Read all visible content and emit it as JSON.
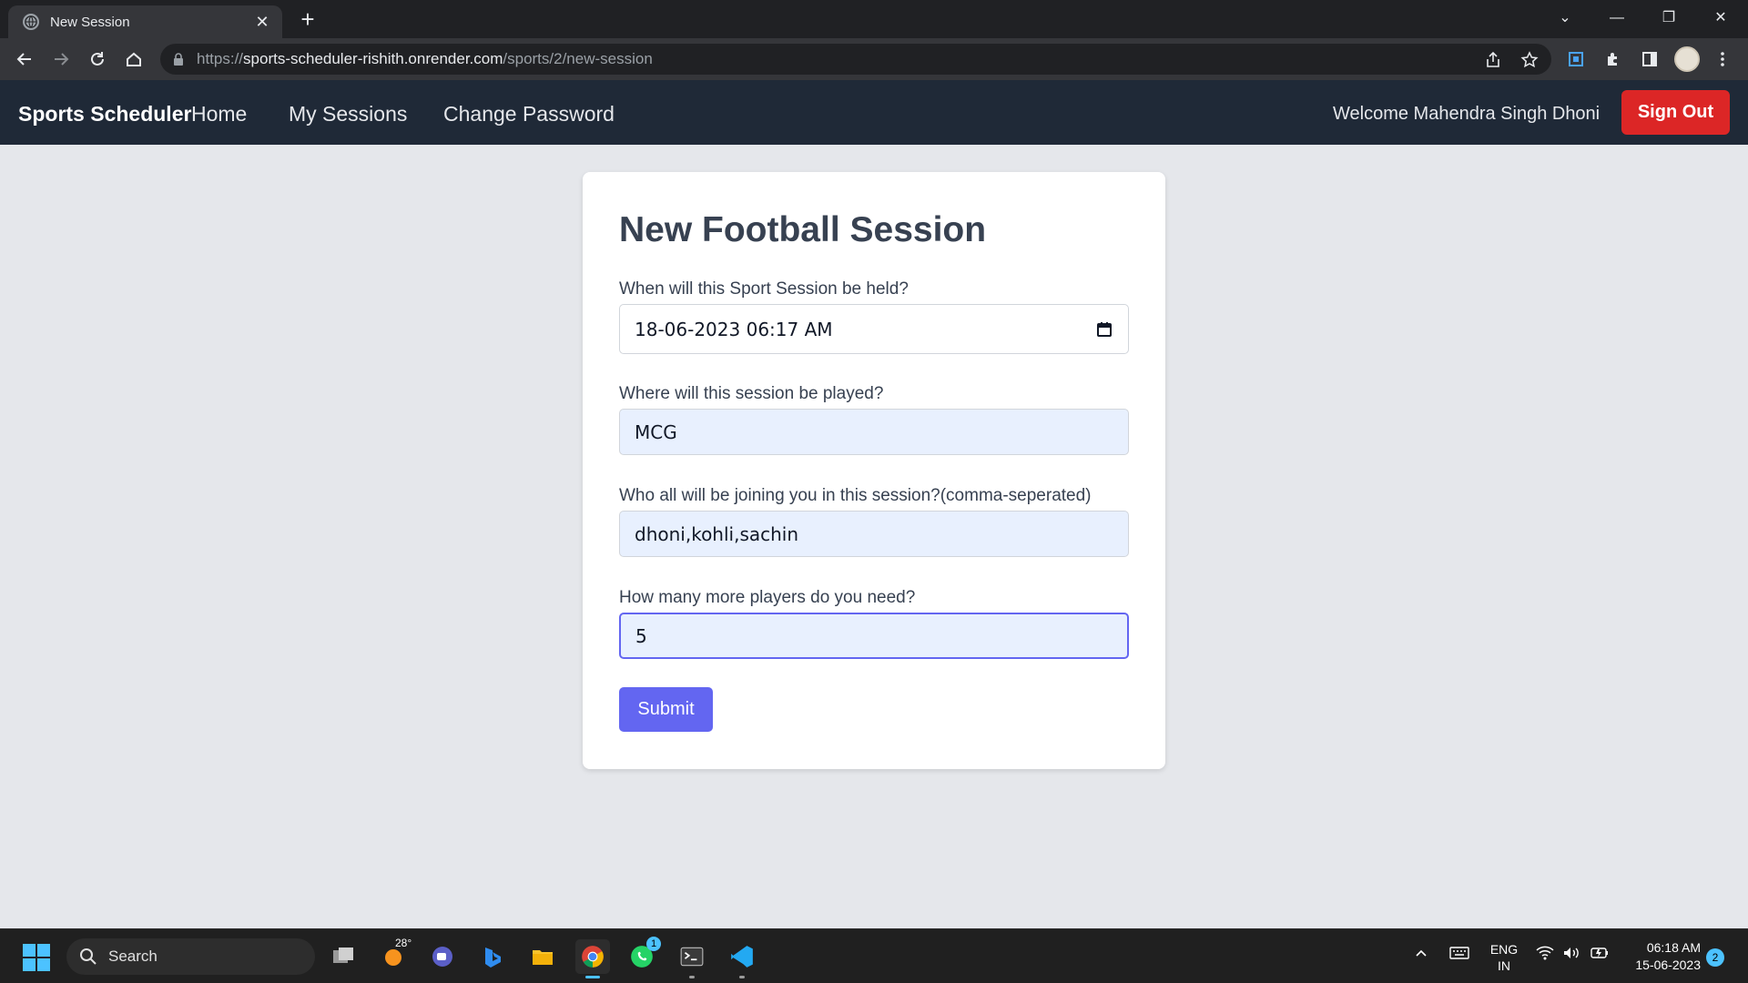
{
  "browser": {
    "tab_title": "New Session",
    "tab_close": "✕",
    "new_tab": "+",
    "url_prefix": "https://",
    "url_host": "sports-scheduler-rishith.onrender.com",
    "url_path": "/sports/2/new-session"
  },
  "navbar": {
    "brand": "Sports Scheduler",
    "links": [
      "Home",
      "My Sessions",
      "Change Password"
    ],
    "welcome": "Welcome Mahendra Singh Dhoni",
    "sign_out": "Sign Out"
  },
  "form": {
    "title": "New Football Session",
    "fields": [
      {
        "label": "When will this Sport Session be held?",
        "value": "18-06-2023  06:17  AM"
      },
      {
        "label": "Where will this session be played?",
        "value": "MCG"
      },
      {
        "label": "Who all will be joining you in this session?(comma-seperated)",
        "value": "dhoni,kohli,sachin"
      },
      {
        "label": "How many more players do you need?",
        "value": "5"
      }
    ],
    "submit": "Submit"
  },
  "taskbar": {
    "search": "Search",
    "weather_temp": "28°",
    "whatsapp_badge": "1",
    "lang_line1": "ENG",
    "lang_line2": "IN",
    "time": "06:18 AM",
    "date": "15-06-2023",
    "notification_count": "2"
  },
  "colors": {
    "navbar_bg": "#1f2937",
    "sign_out_bg": "#dc2626",
    "submit_bg": "#6366f1",
    "page_bg": "#e5e7eb"
  }
}
